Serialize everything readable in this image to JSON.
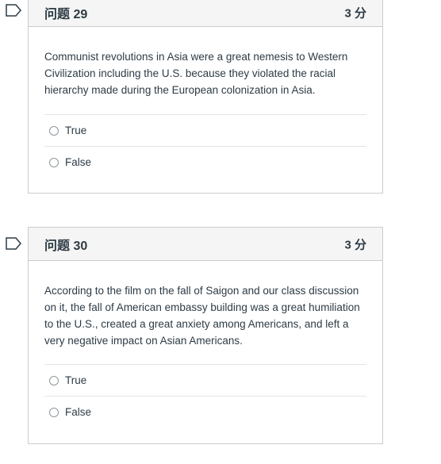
{
  "questions": [
    {
      "title": "问题 29",
      "points": "3 分",
      "text": "Communist revolutions in Asia were a great nemesis to Western Civilization including the U.S. because they violated the racial hierarchy made during the European colonization in Asia.",
      "answers": [
        {
          "label": "True"
        },
        {
          "label": "False"
        }
      ]
    },
    {
      "title": "问题 30",
      "points": "3 分",
      "text": "According to the film on the fall of Saigon and our class discussion on it, the fall of American embassy building was a great humiliation to the U.S., created a great anxiety among Americans, and left a very negative impact on Asian Americans.",
      "answers": [
        {
          "label": "True"
        },
        {
          "label": "False"
        }
      ]
    }
  ],
  "colors": {
    "text": "#2d3b45",
    "border": "#c7cdd1",
    "header_bg": "#f5f5f5",
    "flag_outline": "#2d3b45"
  },
  "icons": {
    "flag": "flag-icon",
    "radio": "radio-unchecked-icon"
  }
}
